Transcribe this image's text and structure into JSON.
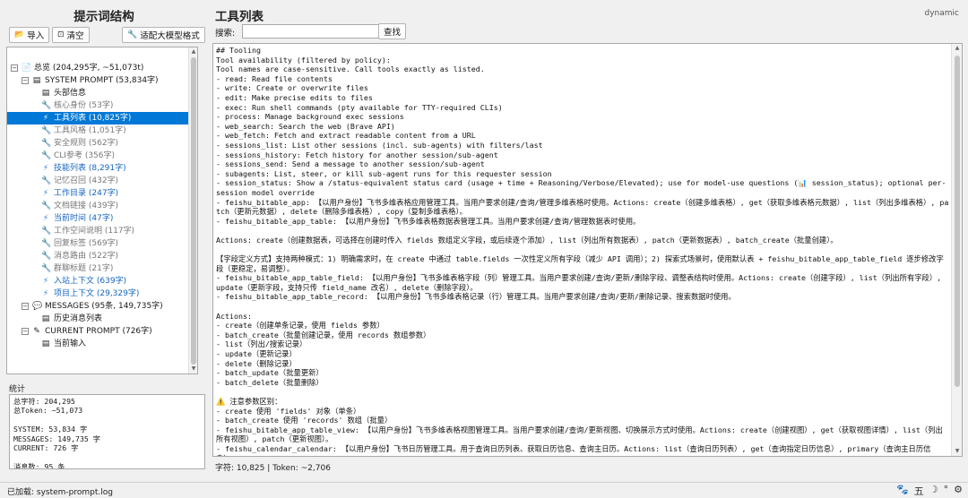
{
  "left": {
    "title": "提示词结构",
    "toolbar": {
      "import_label": "导入",
      "clear_label": "清空",
      "adapt_label": "适配大模型格式"
    },
    "tree": [
      {
        "label": "总览 (204,295字, ~51,073t)",
        "icon": "document-icon",
        "toggle": "⊟",
        "level": 0,
        "style": "normal"
      },
      {
        "label": "SYSTEM PROMPT (53,834字)",
        "icon": "list-icon",
        "toggle": "⊟",
        "level": 1,
        "style": "normal"
      },
      {
        "label": "头部信息",
        "icon": "list-icon",
        "level": 2,
        "style": "normal"
      },
      {
        "label": "核心身份 (53字)",
        "icon": "wrench-icon",
        "level": 2,
        "style": "grey"
      },
      {
        "label": "工具列表 (10,825字)",
        "icon": "bolt-icon",
        "level": 2,
        "style": "selected"
      },
      {
        "label": "工具风格 (1,051字)",
        "icon": "wrench-icon",
        "level": 2,
        "style": "grey"
      },
      {
        "label": "安全规则 (562字)",
        "icon": "wrench-icon",
        "level": 2,
        "style": "grey"
      },
      {
        "label": "CLI参考 (356字)",
        "icon": "wrench-icon",
        "level": 2,
        "style": "grey"
      },
      {
        "label": "技能列表 (8,291字)",
        "icon": "bolt-icon",
        "level": 2,
        "style": "blue"
      },
      {
        "label": "记忆召回 (432字)",
        "icon": "wrench-icon",
        "level": 2,
        "style": "grey"
      },
      {
        "label": "工作目录 (247字)",
        "icon": "bolt-icon",
        "level": 2,
        "style": "blue"
      },
      {
        "label": "文档链接 (439字)",
        "icon": "wrench-icon",
        "level": 2,
        "style": "grey"
      },
      {
        "label": "当前时间 (47字)",
        "icon": "bolt-icon",
        "level": 2,
        "style": "blue"
      },
      {
        "label": "工作空间说明 (117字)",
        "icon": "wrench-icon",
        "level": 2,
        "style": "grey"
      },
      {
        "label": "回复标签 (569字)",
        "icon": "wrench-icon",
        "level": 2,
        "style": "grey"
      },
      {
        "label": "消息路由 (522字)",
        "icon": "wrench-icon",
        "level": 2,
        "style": "grey"
      },
      {
        "label": "群聊标题 (21字)",
        "icon": "wrench-icon",
        "level": 2,
        "style": "grey"
      },
      {
        "label": "入站上下文 (639字)",
        "icon": "bolt-icon",
        "level": 2,
        "style": "blue"
      },
      {
        "label": "项目上下文 (29,329字)",
        "icon": "bolt-icon",
        "level": 2,
        "style": "blue"
      },
      {
        "label": "MESSAGES (95条, 149,735字)",
        "icon": "chat-icon",
        "toggle": "⊟",
        "level": 1,
        "style": "normal"
      },
      {
        "label": "历史消息列表",
        "icon": "list-icon",
        "level": 2,
        "style": "normal"
      },
      {
        "label": "CURRENT PROMPT (726字)",
        "icon": "pencil-icon",
        "toggle": "⊟",
        "level": 1,
        "style": "normal"
      },
      {
        "label": "当前输入",
        "icon": "list-icon",
        "level": 2,
        "style": "normal"
      }
    ],
    "stats_label": "统计",
    "stats_text": "总字符: 204,295\n总Token: ~51,073\n\nSYSTEM: 53,834 字\nMESSAGES: 149,735 字\nCURRENT: 726 字\n\n消息数: 95 条"
  },
  "right": {
    "title": "工具列表",
    "tag": "dynamic",
    "search_label": "搜索:",
    "search_value": "",
    "search_button": "查找",
    "content": "## Tooling\nTool availability (filtered by policy):\nTool names are case-sensitive. Call tools exactly as listed.\n- read: Read file contents\n- write: Create or overwrite files\n- edit: Make precise edits to files\n- exec: Run shell commands (pty available for TTY-required CLIs)\n- process: Manage background exec sessions\n- web_search: Search the web (Brave API)\n- web_fetch: Fetch and extract readable content from a URL\n- sessions_list: List other sessions (incl. sub-agents) with filters/last\n- sessions_history: Fetch history for another session/sub-agent\n- sessions_send: Send a message to another session/sub-agent\n- subagents: List, steer, or kill sub-agent runs for this requester session\n- session_status: Show a /status-equivalent status card (usage + time + Reasoning/Verbose/Elevated); use for model-use questions (📊 session_status); optional per-session model override\n- feishu_bitable_app: 【以用户身份】飞书多维表格应用管理工具。当用户要求创建/查询/管理多维表格时使用。Actions: create（创建多维表格）, get（获取多维表格元数据）, list（列出多维表格）, patch（更新元数据）, delete（删除多维表格）, copy（复制多维表格）。\n- feishu_bitable_app_table: 【以用户身份】飞书多维表格数据表管理工具。当用户要求创建/查询/管理数据表时使用。\n\nActions: create（创建数据表，可选择在创建时传入 fields 数组定义字段，或后续逐个添加）, list（列出所有数据表）, patch（更新数据表）, batch_create（批量创建）。\n\n【字段定义方式】支持两种模式：1) 明确需求时，在 create 中通过 table.fields 一次性定义所有字段（减少 API 调用）；2) 探索式场景时，使用默认表 + feishu_bitable_app_table_field 逐步修改字段（更稳定，易调整）。\n- feishu_bitable_app_table_field: 【以用户身份】飞书多维表格字段（列）管理工具。当用户要求创建/查询/更新/删除字段、调整表结构时使用。Actions: create（创建字段）, list（列出所有字段）, update（更新字段，支持只传 field_name 改名）, delete（删除字段）。\n- feishu_bitable_app_table_record: 【以用户身份】飞书多维表格记录（行）管理工具。当用户要求创建/查询/更新/删除记录、搜索数据时使用。\n\nActions:\n- create（创建单条记录，使用 fields 参数）\n- batch_create（批量创建记录，使用 records 数组参数）\n- list（列出/搜索记录）\n- update（更新记录）\n- delete（删除记录）\n- batch_update（批量更新）\n- batch_delete（批量删除）\n\n⚠️ 注意参数区别：\n- create 使用 'fields' 对象（单条）\n- batch_create 使用 'records' 数组（批量）\n- feishu_bitable_app_table_view: 【以用户身份】飞书多维表格视图管理工具。当用户要求创建/查询/更新视图、切换展示方式时使用。Actions: create（创建视图）, get（获取视图详情）, list（列出所有视图）, patch（更新视图）。\n- feishu_calendar_calendar: 【以用户身份】飞书日历管理工具。用于查询日历列表、获取日历信息、查询主日历。Actions: list（查询日历列表）, get（查询指定日历信息）, primary（查询主日历信息）。",
    "counts": "字符: 10,825 | Token: ~2,706"
  },
  "status": {
    "text": "已加载: system-prompt.log",
    "tray": [
      "paw-icon",
      "五",
      "moon-icon",
      "degree-icon",
      "gear-icon"
    ]
  }
}
